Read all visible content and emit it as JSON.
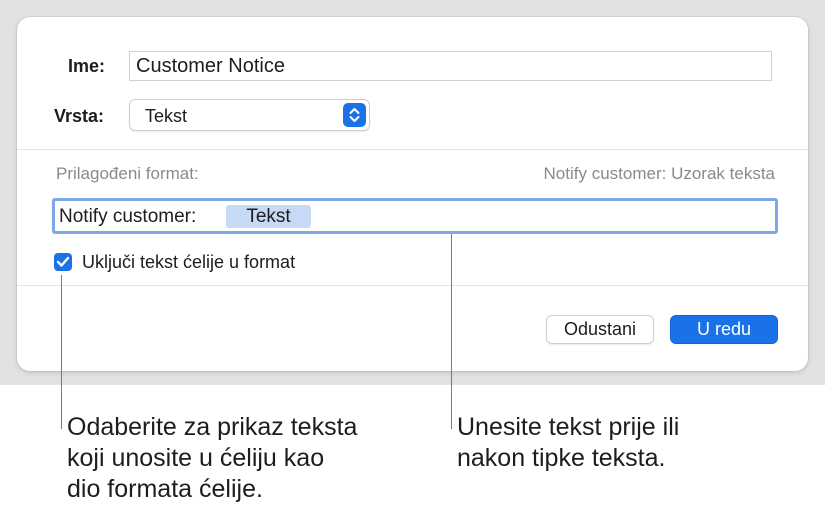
{
  "dialog": {
    "name_label": "Ime:",
    "name_value": "Customer Notice",
    "type_label": "Vrsta:",
    "type_value": "Tekst",
    "custom_format_label": "Prilagođeni format:",
    "sample_text": "Notify customer: Uzorak teksta",
    "format_prefix": "Notify customer:",
    "format_token": "Tekst",
    "include_checkbox_label": "Uključi tekst ćelije u format",
    "include_checked": true,
    "cancel_label": "Odustani",
    "ok_label": "U redu"
  },
  "callouts": {
    "left_lines": [
      "Odaberite za prikaz teksta",
      "koji unosite u ćeliju kao",
      "dio formata ćelije."
    ],
    "right_lines": [
      "Unesite tekst prije ili",
      "nakon tipke teksta."
    ]
  },
  "colors": {
    "accent": "#1a72e8",
    "token_bg": "#c6daf5",
    "focus_ring": "#7da8e6",
    "backdrop": "#e2e2e2"
  },
  "icons": {
    "stepper": "chevron-up-down-icon",
    "checkbox": "checkmark-icon"
  }
}
